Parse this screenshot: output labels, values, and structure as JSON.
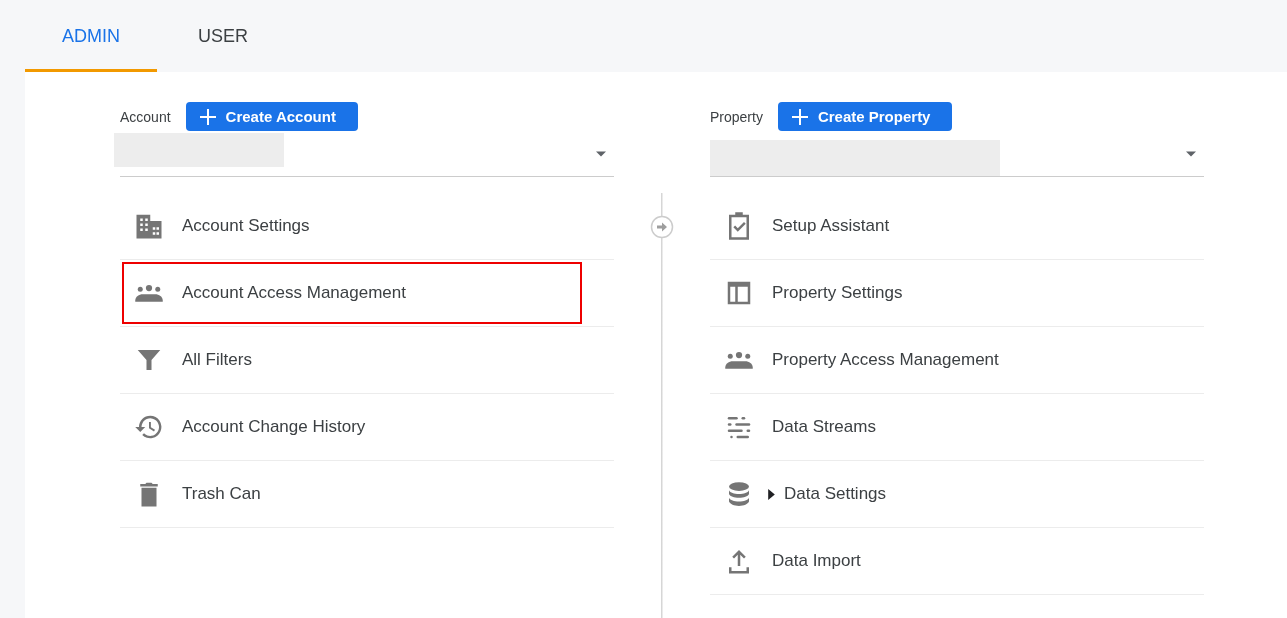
{
  "tabs": [
    {
      "label": "ADMIN",
      "selected": true
    },
    {
      "label": "USER",
      "selected": false
    }
  ],
  "columns": [
    {
      "label": "Account",
      "create_button": "Create Account",
      "items": [
        {
          "label": "Account Settings",
          "kind": "building",
          "highlighted": false
        },
        {
          "label": "Account Access Management",
          "kind": "people",
          "highlighted": true
        },
        {
          "label": "All Filters",
          "kind": "filter",
          "highlighted": false
        },
        {
          "label": "Account Change History",
          "kind": "history",
          "highlighted": false
        },
        {
          "label": "Trash Can",
          "kind": "trash",
          "highlighted": false
        }
      ]
    },
    {
      "label": "Property",
      "create_button": "Create Property",
      "items": [
        {
          "label": "Setup Assistant",
          "kind": "checklist",
          "highlighted": false
        },
        {
          "label": "Property Settings",
          "kind": "layout",
          "highlighted": false
        },
        {
          "label": "Property Access Management",
          "kind": "people",
          "highlighted": false
        },
        {
          "label": "Data Streams",
          "kind": "streams",
          "highlighted": false
        },
        {
          "label": "Data Settings",
          "kind": "database",
          "highlighted": false,
          "expandable": true
        },
        {
          "label": "Data Import",
          "kind": "upload",
          "highlighted": false
        }
      ]
    }
  ]
}
